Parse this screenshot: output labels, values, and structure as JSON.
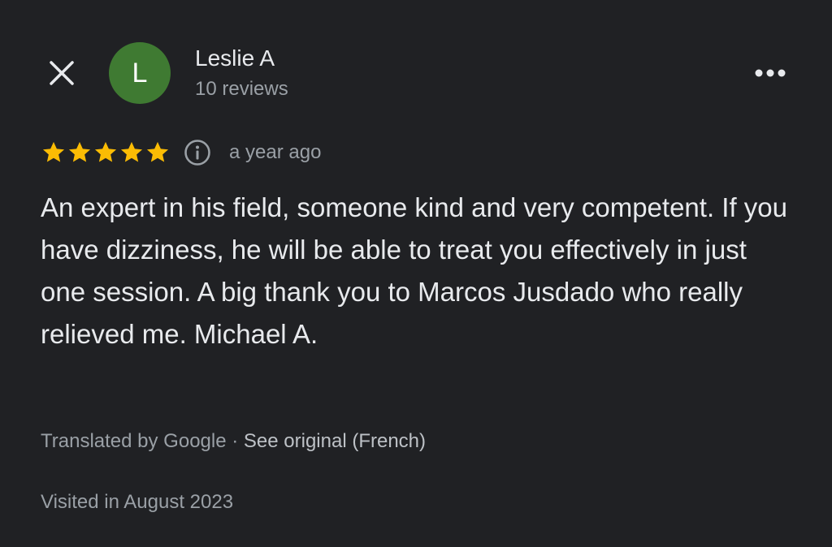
{
  "header": {
    "author_name": "Leslie A",
    "avatar_letter": "L",
    "review_count": "10 reviews"
  },
  "review": {
    "rating": 5,
    "rating_max": 5,
    "time_ago": "a year ago",
    "text": "An expert in his field, someone kind and very competent. If you have dizziness, he will be able to treat you effectively in just one session. A big thank you to Marcos Jusdado who really relieved me. Michael A.",
    "translated_by": "Translated by Google",
    "separator": " · ",
    "see_original": "See original (French)",
    "visited": "Visited in August 2023"
  },
  "colors": {
    "background": "#202124",
    "avatar_bg": "#3f7a32",
    "star": "#fbbc04",
    "primary_text": "#e8eaed",
    "secondary_text": "#9aa0a6"
  },
  "icons": {
    "close": "close-icon",
    "more": "more-horizontal-icon",
    "star": "star-icon",
    "info": "info-icon"
  }
}
